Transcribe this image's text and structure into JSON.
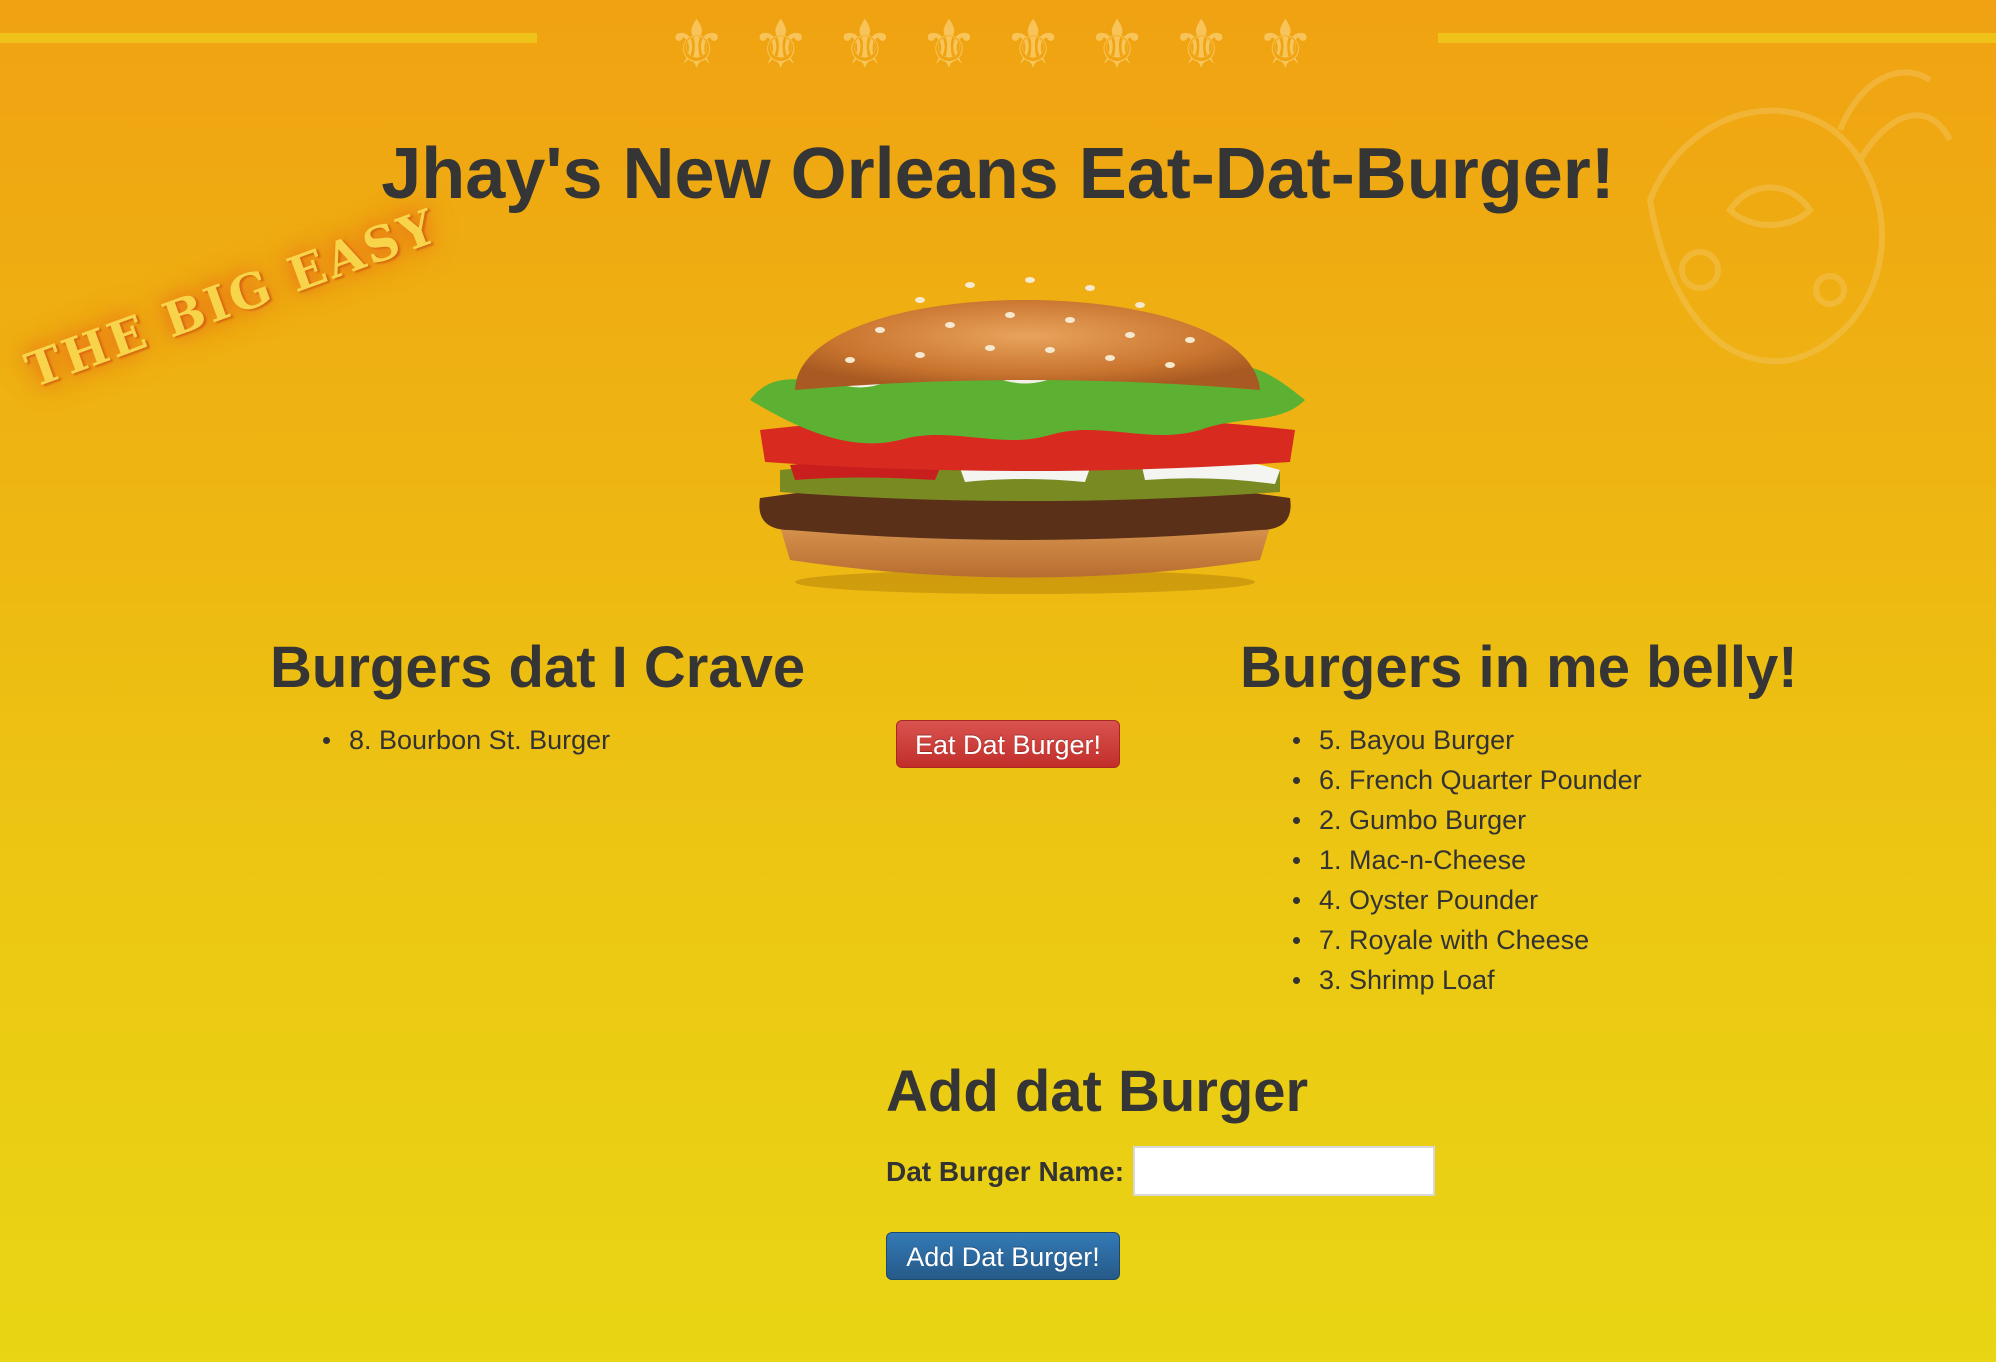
{
  "page": {
    "title": "Jhay's New Orleans Eat-Dat-Burger!",
    "tagline_image_text": "THE BIG EASY"
  },
  "decor": {
    "fleur_glyph": "⚜",
    "fleur_count": 8
  },
  "crave": {
    "heading": "Burgers dat I Crave",
    "items": [
      "8. Bourbon St. Burger"
    ],
    "eat_button_label": "Eat Dat Burger!"
  },
  "belly": {
    "heading": "Burgers in me belly!",
    "items": [
      "5. Bayou Burger",
      "6. French Quarter Pounder",
      "2. Gumbo Burger",
      "1. Mac-n-Cheese",
      "4. Oyster Pounder",
      "7. Royale with Cheese",
      "3. Shrimp Loaf"
    ]
  },
  "add_form": {
    "heading": "Add dat Burger",
    "name_label": "Dat Burger Name:",
    "name_value": "",
    "submit_label": "Add Dat Burger!"
  },
  "colors": {
    "eat_button": "#d9534f",
    "add_button": "#337ab7",
    "heading_text": "#353535"
  }
}
